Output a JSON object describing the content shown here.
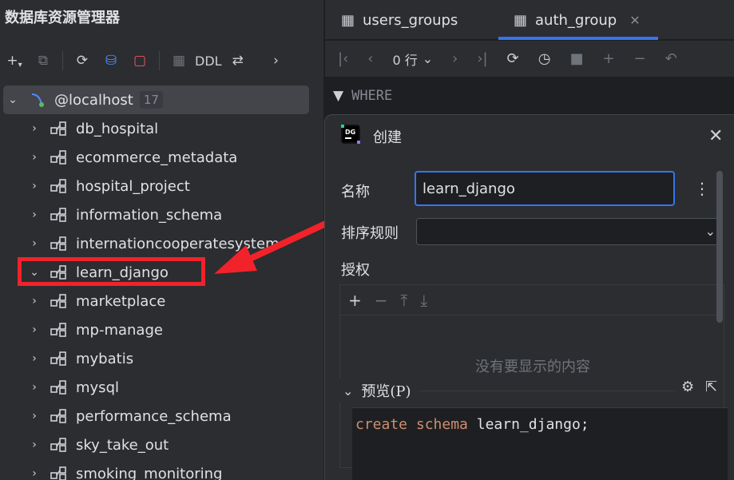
{
  "left_panel": {
    "title": "数据库资源管理器",
    "toolbar": {
      "ddl_label": "DDL"
    },
    "root": {
      "label": "@localhost",
      "count": "17"
    },
    "schemas": [
      {
        "label": "db_hospital",
        "expanded": false
      },
      {
        "label": "ecommerce_metadata",
        "expanded": false
      },
      {
        "label": "hospital_project",
        "expanded": false
      },
      {
        "label": "information_schema",
        "expanded": false
      },
      {
        "label": "internationcooperatesystem",
        "expanded": false
      },
      {
        "label": "learn_django",
        "expanded": true
      },
      {
        "label": "marketplace",
        "expanded": false
      },
      {
        "label": "mp-manage",
        "expanded": false
      },
      {
        "label": "mybatis",
        "expanded": false
      },
      {
        "label": "mysql",
        "expanded": false
      },
      {
        "label": "performance_schema",
        "expanded": false
      },
      {
        "label": "sky_take_out",
        "expanded": false
      },
      {
        "label": "smoking_monitoring",
        "expanded": false
      }
    ]
  },
  "tabs": [
    {
      "label": "users_groups"
    },
    {
      "label": "auth_group"
    }
  ],
  "table_toolbar": {
    "row_count": "0 行"
  },
  "filter": {
    "label": "WHERE"
  },
  "dialog": {
    "title": "创建",
    "name_label": "名称",
    "name_value": "learn_django",
    "collation_label": "排序规则",
    "collation_value": "",
    "grant_label": "授权",
    "grant_empty": "没有要显示的内容",
    "preview_label": "预览(P)",
    "sql": {
      "kw1": "create",
      "kw2": "schema",
      "rest": "learn_django;"
    }
  },
  "colors": {
    "accent": "#3574f0",
    "highlight": "#f2222a",
    "keyword": "#cf8e6d"
  }
}
